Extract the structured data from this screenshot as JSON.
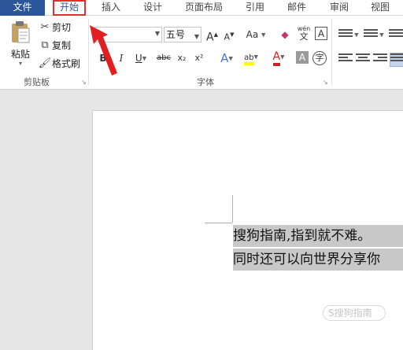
{
  "tabs": {
    "file": "文件",
    "home": "开始",
    "insert": "插入",
    "design": "设计",
    "layout": "页面布局",
    "references": "引用",
    "mailings": "邮件",
    "review": "审阅",
    "view": "视图"
  },
  "clipboard": {
    "paste_label": "粘贴",
    "cut_label": "剪切",
    "copy_label": "复制",
    "format_painter_label": "格式刷",
    "group_label": "剪贴板"
  },
  "font": {
    "font_name_value": "",
    "font_size_value": "五号",
    "grow_label": "A",
    "shrink_label": "A",
    "case_label": "Aa",
    "phonetic_label": "wén",
    "phonetic_sub": "文",
    "border_char_label": "A",
    "bold_label": "B",
    "italic_label": "I",
    "underline_label": "U",
    "strike_label": "abc",
    "subscript_label": "x₂",
    "superscript_label": "x²",
    "effect_label": "A",
    "highlight_label": "ab",
    "color_label": "A",
    "shade_label": "A",
    "enclose_label": "字",
    "group_label": "字体"
  },
  "document": {
    "line1": "搜狗指南,指到就不难。",
    "line2": "同时还可以向世界分享你"
  },
  "watermark_text": "S搜狗指南",
  "colors": {
    "file_tab": "#2b579a",
    "highlight_box": "#e03030",
    "selection": "#c8c8c8",
    "font_color": "#d02020",
    "highlight_color": "#ffff00"
  }
}
